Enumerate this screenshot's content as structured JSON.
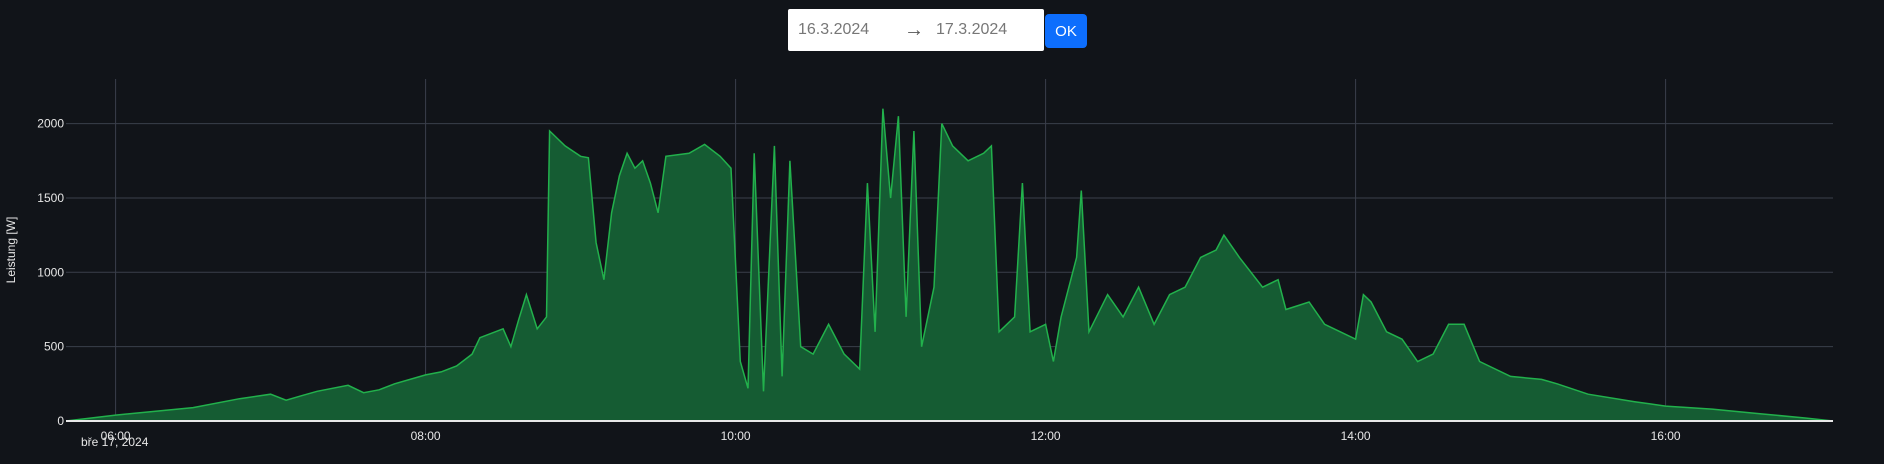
{
  "date_range": {
    "start": "16.3.2024",
    "arrow": "→",
    "end": "17.3.2024",
    "ok_label": "OK"
  },
  "colors": {
    "line": "#22b14c",
    "fill": "#155c33",
    "background": "#111419",
    "grid": "#3a3f4b",
    "button": "#0d6efd"
  },
  "chart_data": {
    "type": "area",
    "title": "",
    "xlabel": "",
    "ylabel": "Leistung [W]",
    "date_label": "bře 17, 2024",
    "xlim": [
      5.68,
      17.08
    ],
    "ylim": [
      0,
      2300
    ],
    "grid": true,
    "x_ticks": [
      6,
      8,
      10,
      12,
      14,
      16
    ],
    "x_tick_labels": [
      "06:00",
      "08:00",
      "10:00",
      "12:00",
      "14:00",
      "16:00"
    ],
    "y_ticks": [
      0,
      500,
      1000,
      1500,
      2000
    ],
    "y_tick_labels": [
      "0",
      "500",
      "1000",
      "1500",
      "2000"
    ],
    "series": [
      {
        "name": "Leistung",
        "x": [
          5.68,
          6.0,
          6.3,
          6.5,
          6.8,
          7.0,
          7.1,
          7.2,
          7.3,
          7.5,
          7.6,
          7.7,
          7.8,
          8.0,
          8.1,
          8.2,
          8.3,
          8.35,
          8.5,
          8.55,
          8.6,
          8.65,
          8.72,
          8.78,
          8.8,
          8.85,
          8.9,
          9.0,
          9.05,
          9.1,
          9.15,
          9.2,
          9.25,
          9.3,
          9.35,
          9.4,
          9.45,
          9.5,
          9.55,
          9.7,
          9.8,
          9.9,
          9.97,
          10.03,
          10.08,
          10.12,
          10.18,
          10.25,
          10.3,
          10.35,
          10.42,
          10.5,
          10.6,
          10.7,
          10.8,
          10.85,
          10.9,
          10.95,
          11.0,
          11.05,
          11.1,
          11.15,
          11.2,
          11.28,
          11.33,
          11.4,
          11.5,
          11.6,
          11.65,
          11.7,
          11.8,
          11.85,
          11.9,
          12.0,
          12.05,
          12.1,
          12.2,
          12.23,
          12.28,
          12.4,
          12.5,
          12.6,
          12.7,
          12.8,
          12.9,
          13.0,
          13.1,
          13.15,
          13.25,
          13.4,
          13.5,
          13.55,
          13.7,
          13.8,
          14.0,
          14.05,
          14.1,
          14.2,
          14.3,
          14.4,
          14.5,
          14.6,
          14.7,
          14.8,
          15.0,
          15.2,
          15.3,
          15.5,
          15.8,
          16.0,
          16.3,
          16.6,
          16.9,
          17.08
        ],
        "y": [
          0,
          40,
          70,
          90,
          150,
          180,
          140,
          170,
          200,
          240,
          190,
          210,
          250,
          310,
          330,
          370,
          450,
          560,
          620,
          500,
          680,
          850,
          620,
          700,
          1950,
          1900,
          1850,
          1780,
          1770,
          1200,
          950,
          1400,
          1650,
          1800,
          1700,
          1750,
          1600,
          1400,
          1780,
          1800,
          1860,
          1780,
          1700,
          400,
          220,
          1800,
          200,
          1850,
          300,
          1750,
          500,
          450,
          650,
          450,
          350,
          1600,
          600,
          2100,
          1500,
          2050,
          700,
          1950,
          500,
          900,
          2000,
          1850,
          1750,
          1800,
          1850,
          600,
          700,
          1600,
          600,
          650,
          400,
          700,
          1100,
          1550,
          600,
          850,
          700,
          900,
          650,
          850,
          900,
          1100,
          1150,
          1250,
          1100,
          900,
          950,
          750,
          800,
          650,
          550,
          850,
          800,
          600,
          550,
          400,
          450,
          650,
          650,
          400,
          300,
          280,
          250,
          180,
          130,
          100,
          80,
          50,
          20,
          0
        ]
      }
    ]
  }
}
